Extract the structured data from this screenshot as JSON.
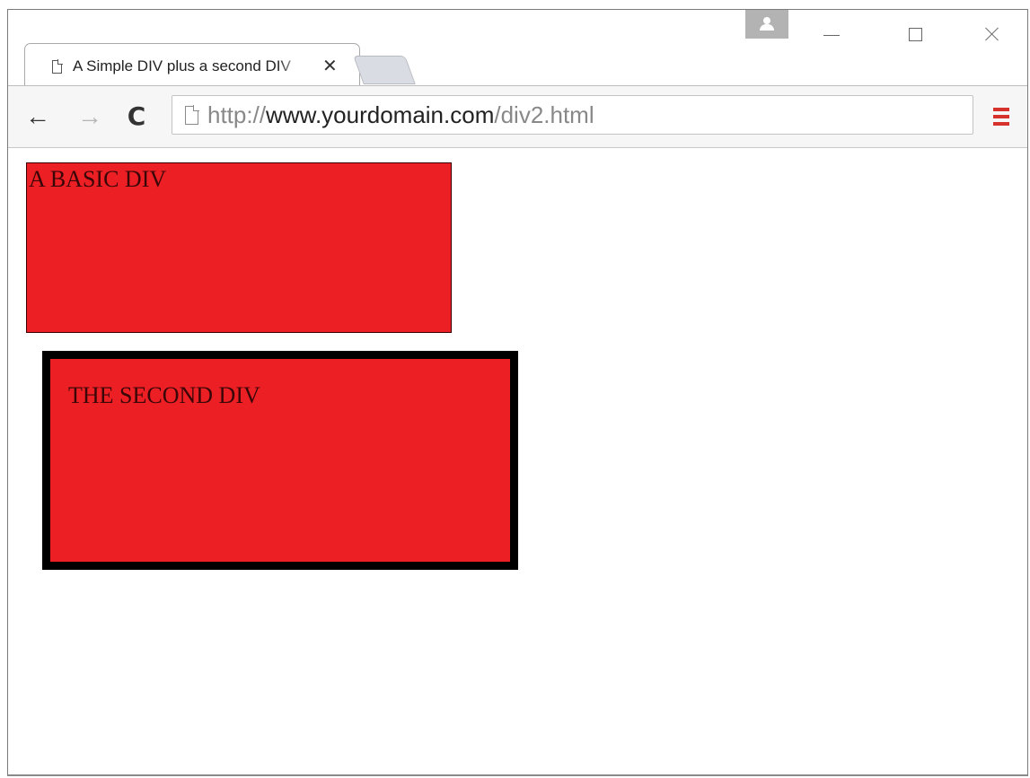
{
  "browser": {
    "tab": {
      "title": "A Simple DIV plus a second DIV",
      "close_glyph": "✕"
    },
    "toolbar": {
      "back_glyph": "←",
      "forward_glyph": "→",
      "reload_glyph": "C",
      "url": {
        "scheme": "http://",
        "host": "www.yourdomain.com",
        "path": "/div2.html"
      }
    },
    "icons": {
      "profile": "profile-icon",
      "minimize": "minimize-icon",
      "maximize": "maximize-icon",
      "close": "close-icon",
      "page": "page-icon",
      "menu": "hamburger-menu-icon"
    },
    "colors": {
      "menu_accent": "#d6312b",
      "div_fill": "#ec1f24",
      "div2_border": "#000000"
    }
  },
  "page": {
    "div1_text": "A BASIC DIV",
    "div2_text": "THE SECOND DIV"
  }
}
